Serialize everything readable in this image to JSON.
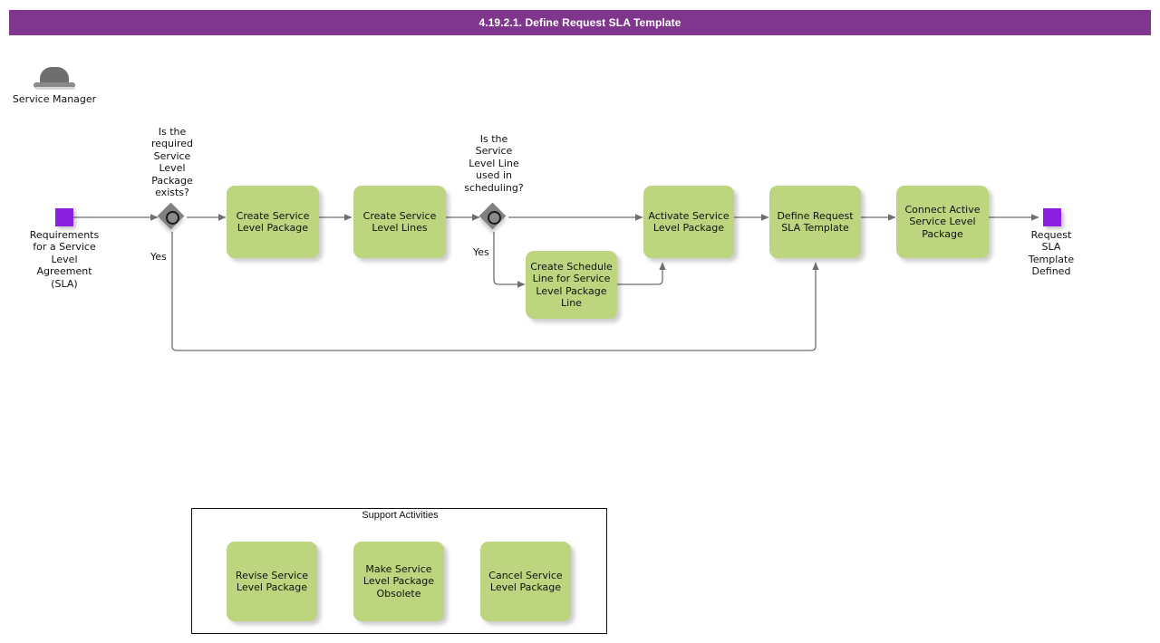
{
  "titlebar": {
    "title": "4.19.2.1. Define Request SLA Template",
    "bg_color": "#80368C",
    "text_color": "#FFFFFF"
  },
  "colors": {
    "task_fill": "#BDD57E",
    "event_fill": "#8B1FE0",
    "gateway_fill": "#808080",
    "connector": "#6E6E6E",
    "canvas_bg": "#FFFFFF"
  },
  "role": {
    "icon": "bowler-hat-icon",
    "label": "Service\nManager"
  },
  "events": [
    {
      "id": "start",
      "type": "start-event",
      "label": "Requirements\nfor a Service\nLevel\nAgreement\n(SLA)"
    },
    {
      "id": "end",
      "type": "end-event",
      "label": "Request\nSLA\nTemplate\nDefined"
    }
  ],
  "gateways": [
    {
      "id": "gw1",
      "type": "inclusive-gateway",
      "label": "Is the\nrequired\nService\nLevel\nPackage\nexists?",
      "outgoing_label": "Yes"
    },
    {
      "id": "gw2",
      "type": "inclusive-gateway",
      "label": "Is the\nService\nLevel Line\nused in\nscheduling?",
      "outgoing_label": "Yes"
    }
  ],
  "tasks": [
    {
      "id": "t1",
      "label": "Create Service\nLevel Package"
    },
    {
      "id": "t2",
      "label": "Create Service\nLevel Lines"
    },
    {
      "id": "t3",
      "label": "Create Schedule\nLine for Service\nLevel Package\nLine"
    },
    {
      "id": "t4",
      "label": "Activate Service\nLevel Package"
    },
    {
      "id": "t5",
      "label": "Define Request\nSLA Template"
    },
    {
      "id": "t6",
      "label": "Connect Active\nService Level\nPackage"
    }
  ],
  "support": {
    "title": "Support Activities",
    "tasks": [
      {
        "id": "s1",
        "label": "Revise Service\nLevel Package"
      },
      {
        "id": "s2",
        "label": "Make Service\nLevel Package\nObsolete"
      },
      {
        "id": "s3",
        "label": "Cancel Service\nLevel Package"
      }
    ]
  }
}
